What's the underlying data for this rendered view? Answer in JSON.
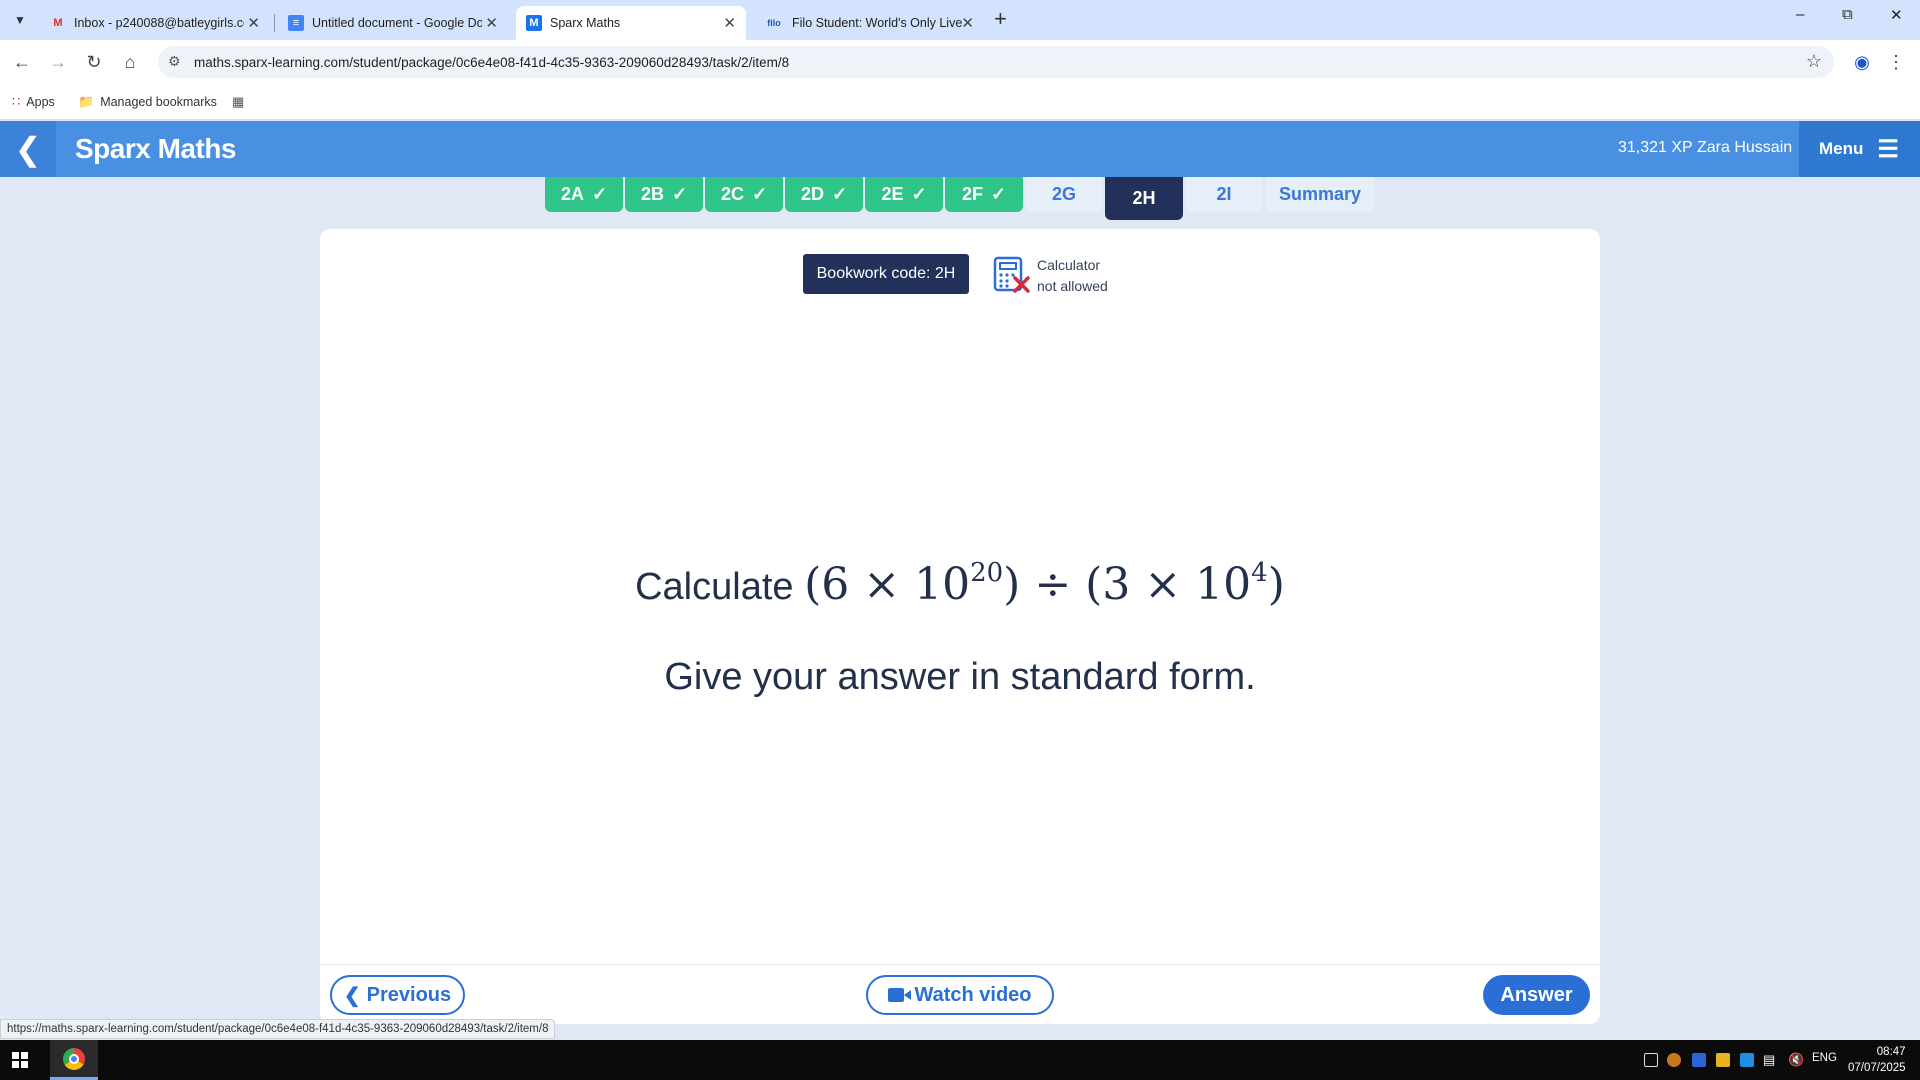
{
  "browser": {
    "tabs": [
      {
        "title": "Inbox - p240088@batleygirls.co",
        "icon": "gmail-icon",
        "active": false
      },
      {
        "title": "Untitled document - Google Do",
        "icon": "docs-icon",
        "active": false
      },
      {
        "title": "Sparx Maths",
        "icon": "sparx-icon",
        "active": true
      },
      {
        "title": "Filo Student: World's Only Live",
        "icon": "filo-icon",
        "active": false
      }
    ],
    "url": "maths.sparx-learning.com/student/package/0c6e4e08-f41d-4c35-9363-209060d28493/task/2/item/8",
    "bookmarks": {
      "apps": "Apps",
      "managed": "Managed bookmarks"
    },
    "status_url": "https://maths.sparx-learning.com/student/package/0c6e4e08-f41d-4c35-9363-209060d28493/task/2/item/8"
  },
  "header": {
    "brand": "Sparx Maths",
    "xp": "31,321 XP",
    "user": "Zara Hussain",
    "menu_label": "Menu"
  },
  "task_tabs": [
    {
      "label": "2A",
      "state": "done"
    },
    {
      "label": "2B",
      "state": "done"
    },
    {
      "label": "2C",
      "state": "done"
    },
    {
      "label": "2D",
      "state": "done"
    },
    {
      "label": "2E",
      "state": "done"
    },
    {
      "label": "2F",
      "state": "done"
    },
    {
      "label": "2G",
      "state": "todo"
    },
    {
      "label": "2H",
      "state": "current"
    },
    {
      "label": "2I",
      "state": "todo"
    },
    {
      "label": "Summary",
      "state": "todo"
    }
  ],
  "question": {
    "bookwork_code": "Bookwork code: 2H",
    "calculator_line1": "Calculator",
    "calculator_line2": "not allowed",
    "calculate_word": "Calculate",
    "math": {
      "open1": "(6 × 10",
      "exp1": "20",
      "mid": ") ÷ (3 × 10",
      "exp2": "4",
      "close": ")"
    },
    "instruction": "Give your answer in standard form."
  },
  "footer": {
    "previous": "Previous",
    "watch_video": "Watch video",
    "answer": "Answer"
  },
  "taskbar": {
    "language": "ENG",
    "time": "08:47",
    "date": "07/07/2025"
  },
  "colors": {
    "header_blue": "#4a90e2",
    "done_green": "#2fc58a",
    "current_navy": "#23305a",
    "button_blue": "#2a6fd6",
    "calc_red": "#e0243a"
  }
}
